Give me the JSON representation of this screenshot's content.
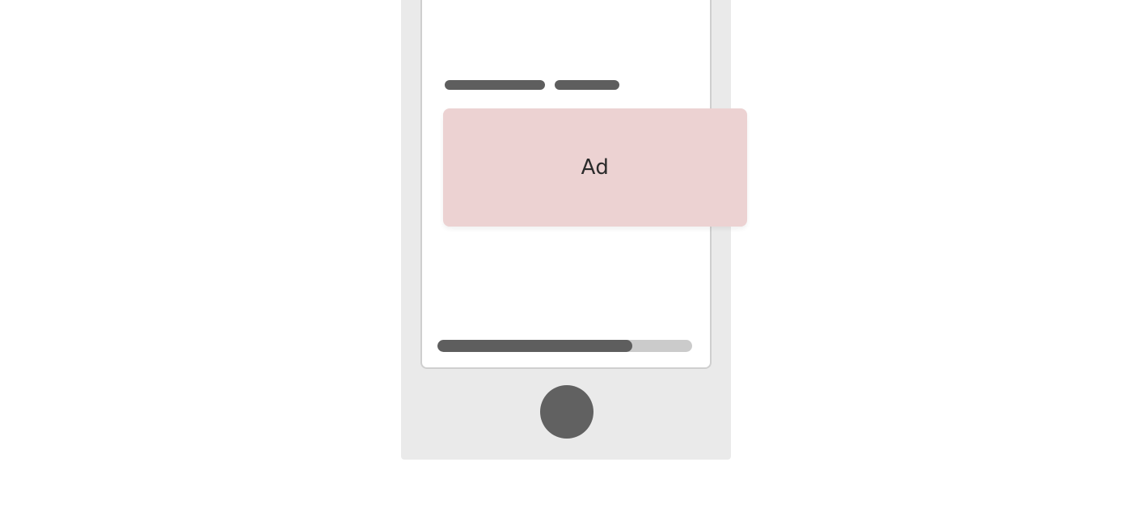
{
  "ad": {
    "label": "Ad",
    "background_color": "#ecd2d2"
  },
  "progress": {
    "fraction": 0.765
  },
  "colors": {
    "device_body": "#eaeaea",
    "placeholder_dark": "#5e5e5e",
    "track": "#cbcbcb"
  }
}
